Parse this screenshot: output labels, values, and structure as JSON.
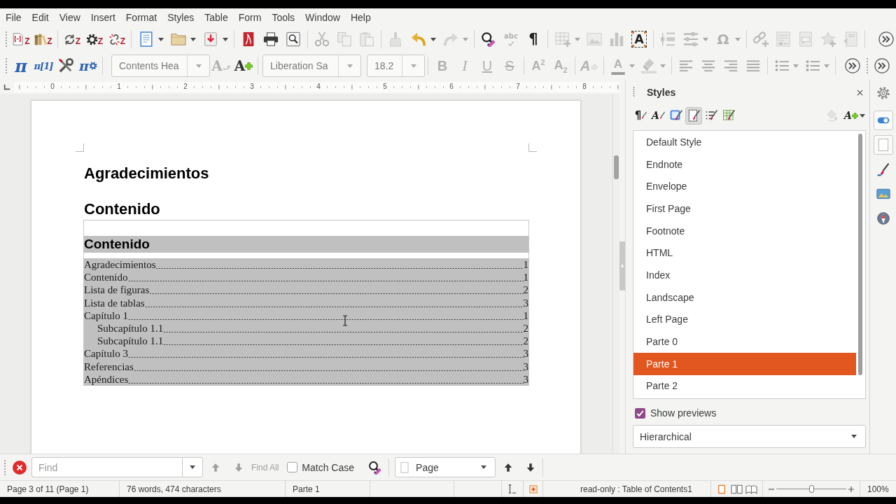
{
  "menu": [
    "File",
    "Edit",
    "View",
    "Insert",
    "Format",
    "Styles",
    "Table",
    "Form",
    "Tools",
    "Window",
    "Help"
  ],
  "standard_toolbar": {
    "groups": [
      [
        {
          "kind": "button",
          "disabled": false,
          "glyph": "Z"
        },
        {
          "kind": "button",
          "disabled": false,
          "glyph": "Z"
        }
      ],
      [
        {
          "kind": "button",
          "disabled": false,
          "glyph": "Z"
        },
        {
          "kind": "button",
          "disabled": false,
          "glyph": "Z"
        },
        {
          "kind": "button",
          "disabled": false,
          "glyph": "Z"
        }
      ],
      [
        {
          "kind": "split",
          "disabled": false
        },
        {
          "kind": "split",
          "disabled": false
        },
        {
          "kind": "split",
          "disabled": false
        }
      ],
      [
        {
          "kind": "button",
          "disabled": false
        },
        {
          "kind": "button",
          "disabled": false
        },
        {
          "kind": "button",
          "disabled": false
        }
      ],
      [
        {
          "kind": "button",
          "disabled": true
        },
        {
          "kind": "button",
          "disabled": true
        },
        {
          "kind": "button",
          "disabled": true
        }
      ],
      [
        {
          "kind": "button",
          "disabled": true
        },
        {
          "kind": "split",
          "disabled": false
        },
        {
          "kind": "split",
          "disabled": true
        }
      ],
      [
        {
          "kind": "button",
          "disabled": false
        },
        {
          "kind": "button",
          "disabled": true,
          "glyph": "abc"
        },
        {
          "kind": "button",
          "disabled": false,
          "glyph": "¶"
        }
      ],
      [
        {
          "kind": "split",
          "disabled": true
        },
        {
          "kind": "button",
          "disabled": true
        },
        {
          "kind": "button",
          "disabled": true
        },
        {
          "kind": "button",
          "disabled": false,
          "glyph": "A"
        }
      ],
      [
        {
          "kind": "button",
          "disabled": true
        },
        {
          "kind": "split",
          "disabled": true
        },
        {
          "kind": "split",
          "disabled": true,
          "glyph": "Ω"
        }
      ],
      [
        {
          "kind": "button",
          "disabled": true
        },
        {
          "kind": "button",
          "disabled": true
        },
        {
          "kind": "button",
          "disabled": true
        },
        {
          "kind": "button",
          "disabled": true
        },
        {
          "kind": "button",
          "disabled": true
        }
      ],
      [
        {
          "kind": "overflow",
          "disabled": false
        }
      ]
    ]
  },
  "formatting_toolbar": {
    "groups": [
      [
        {
          "kind": "button",
          "disabled": false,
          "glyph": "π"
        },
        {
          "kind": "button",
          "disabled": false,
          "glyph": "π[1]"
        },
        {
          "kind": "button",
          "disabled": false
        },
        {
          "kind": "button",
          "disabled": false,
          "glyph": "π"
        }
      ],
      [
        {
          "kind": "combo",
          "disabled": true,
          "value": "Contents Hea"
        },
        {
          "kind": "button",
          "disabled": true,
          "glyph": "A"
        },
        {
          "kind": "button",
          "disabled": false,
          "glyph": "A"
        }
      ],
      [
        {
          "kind": "combo",
          "disabled": true,
          "value": "Liberation Sa"
        },
        {
          "kind": "combo",
          "disabled": true,
          "value": "18.2"
        }
      ],
      [
        {
          "kind": "button",
          "disabled": true,
          "glyph": "B"
        },
        {
          "kind": "button",
          "disabled": true,
          "glyph": "I"
        },
        {
          "kind": "button",
          "disabled": true,
          "glyph": "U"
        },
        {
          "kind": "button",
          "disabled": true,
          "glyph": "S"
        }
      ],
      [
        {
          "kind": "button",
          "disabled": true,
          "glyph": "A$^{2}$"
        },
        {
          "kind": "button",
          "disabled": true,
          "glyph": "A$_{2}$"
        }
      ],
      [
        {
          "kind": "button",
          "disabled": true,
          "glyph": "A"
        }
      ],
      [
        {
          "kind": "split",
          "disabled": true,
          "glyph": "A"
        },
        {
          "kind": "split",
          "disabled": true
        }
      ],
      [
        {
          "kind": "button",
          "disabled": true
        },
        {
          "kind": "button",
          "disabled": true
        },
        {
          "kind": "button",
          "disabled": true
        },
        {
          "kind": "button",
          "disabled": true
        }
      ],
      [
        {
          "kind": "split",
          "disabled": true
        },
        {
          "kind": "split",
          "disabled": true
        }
      ],
      [
        {
          "kind": "overflow",
          "disabled": false
        }
      ]
    ]
  },
  "extra_toolbar": {
    "groups": [
      [
        {
          "kind": "overflow",
          "disabled": false
        }
      ]
    ]
  },
  "ruler": {
    "labels": [
      "0",
      "1",
      "2",
      "3",
      "4",
      "5",
      "6",
      "7",
      "8"
    ]
  },
  "document": {
    "headings": [
      "Agradecimientos",
      "Contenido"
    ],
    "toc": {
      "title": "Contenido",
      "entries": [
        {
          "text": "Agradecimientos",
          "page": "1"
        },
        {
          "text": "Contenido",
          "page": "1"
        },
        {
          "text": "Lista de figuras",
          "page": "2"
        },
        {
          "text": "Lista de tablas",
          "page": "3"
        },
        {
          "text": "Capítulo 1",
          "page": "1",
          "children": [
            {
              "text": "Subcapítulo 1.1",
              "page": "2"
            },
            {
              "text": "Subcapítulo 1.1",
              "page": "2"
            }
          ]
        },
        {
          "text": "Capítulo 3",
          "page": "3"
        },
        {
          "text": "Referencias",
          "page": "3"
        },
        {
          "text": "Apéndices",
          "page": "3"
        }
      ]
    }
  },
  "sidebar": {
    "title": "Styles",
    "families": [
      {
        "selected": false,
        "glyph": "¶"
      },
      {
        "selected": false,
        "glyph": "A"
      },
      {
        "selected": false
      },
      {
        "selected": true
      },
      {
        "selected": false
      },
      {
        "selected": false
      }
    ],
    "actions": [
      {
        "kind": "fill",
        "disabled": true
      },
      {
        "kind": "new",
        "disabled": false,
        "glyph": "A"
      }
    ],
    "styles": [
      {
        "name": "Default Style",
        "selected": false
      },
      {
        "name": "Endnote",
        "selected": false
      },
      {
        "name": "Envelope",
        "selected": false
      },
      {
        "name": "First Page",
        "selected": false
      },
      {
        "name": "Footnote",
        "selected": false
      },
      {
        "name": "HTML",
        "selected": false
      },
      {
        "name": "Index",
        "selected": false
      },
      {
        "name": "Landscape",
        "selected": false
      },
      {
        "name": "Left Page",
        "selected": false
      },
      {
        "name": "Parte 0",
        "selected": false
      },
      {
        "name": "Parte 1",
        "selected": true
      },
      {
        "name": "Parte 2",
        "selected": false
      }
    ],
    "show_previews": {
      "label": "Show previews",
      "checked": true
    },
    "filter": {
      "value": "Hierarchical"
    }
  },
  "find_bar": {
    "placeholder": "Find",
    "find_previous": {
      "disabled": true
    },
    "find_next": {
      "disabled": true
    },
    "find_all": {
      "label": "Find All",
      "disabled": true
    },
    "match_case": {
      "label": "Match Case",
      "checked": false
    },
    "navigate_by": {
      "value": "Page"
    },
    "navigate_previous": {
      "disabled": false
    },
    "navigate_next": {
      "disabled": false
    }
  },
  "status_bar": {
    "page": "Page 3 of 11 (Page 1)",
    "words": "76 words, 474 characters",
    "page_style": "Parte 1",
    "modified": true,
    "mode": "read-only : Table of Contents1",
    "view_layouts": [
      {
        "selected": true
      },
      {
        "selected": false
      },
      {
        "selected": false
      }
    ],
    "zoom": {
      "level": 0.5,
      "label": "100%"
    }
  }
}
